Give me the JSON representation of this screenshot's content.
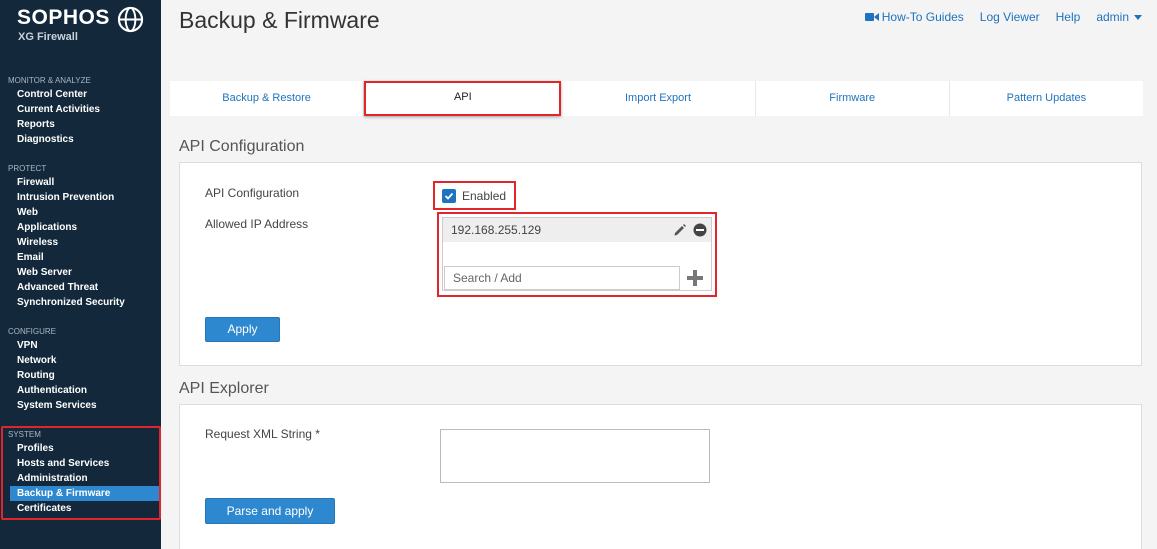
{
  "brand": {
    "name": "SOPHOS",
    "product": "XG Firewall"
  },
  "page": {
    "title": "Backup & Firmware"
  },
  "toplinks": {
    "howto": "How-To Guides",
    "logviewer": "Log Viewer",
    "help": "Help",
    "user": "admin"
  },
  "sidebar": {
    "monitor": {
      "header": "MONITOR & ANALYZE",
      "items": [
        "Control Center",
        "Current Activities",
        "Reports",
        "Diagnostics"
      ]
    },
    "protect": {
      "header": "PROTECT",
      "items": [
        "Firewall",
        "Intrusion Prevention",
        "Web",
        "Applications",
        "Wireless",
        "Email",
        "Web Server",
        "Advanced Threat",
        "Synchronized Security"
      ]
    },
    "configure": {
      "header": "CONFIGURE",
      "items": [
        "VPN",
        "Network",
        "Routing",
        "Authentication",
        "System Services"
      ]
    },
    "system": {
      "header": "SYSTEM",
      "items": [
        "Profiles",
        "Hosts and Services",
        "Administration",
        "Backup & Firmware",
        "Certificates"
      ]
    }
  },
  "tabs": [
    "Backup & Restore",
    "API",
    "Import Export",
    "Firmware",
    "Pattern Updates"
  ],
  "api_config": {
    "section_title": "API Configuration",
    "label_config": "API Configuration",
    "checkbox_label": "Enabled",
    "label_allowed": "Allowed IP Address",
    "ip_entry": "192.168.255.129",
    "search_placeholder": "Search / Add",
    "apply": "Apply"
  },
  "api_explorer": {
    "section_title": "API Explorer",
    "label_request": "Request XML String *",
    "parse_apply": "Parse and apply"
  },
  "colors": {
    "sidebar": "#13293b",
    "accent": "#2d88cf",
    "highlight": "#e0262a",
    "link": "#1e73be"
  }
}
